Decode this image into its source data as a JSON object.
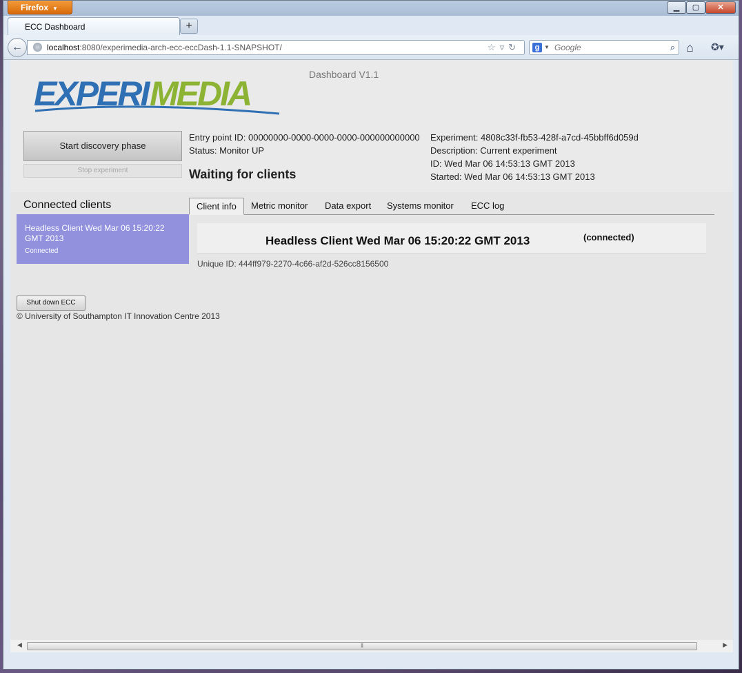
{
  "browser": {
    "app_button": "Firefox",
    "tab_title": "ECC Dashboard",
    "new_tab": "+",
    "url_host": "localhost",
    "url_rest": ":8080/experimedia-arch-ecc-eccDash-1.1-SNAPSHOT/",
    "search_placeholder": "Google",
    "controls": {
      "minimize": "▁",
      "maximize": "▢",
      "close": "✕"
    }
  },
  "header": {
    "logo_text_a": "EXPERI",
    "logo_text_b": "MEDIA",
    "version": "Dashboard V1.1",
    "start_button": "Start discovery phase",
    "stop_button": "Stop experiment",
    "entry_point": "Entry point ID: 00000000-0000-0000-0000-000000000000",
    "status": "Status: Monitor UP",
    "waiting": "Waiting for clients",
    "experiment": "Experiment: 4808c33f-fb53-428f-a7cd-45bbff6d059d",
    "description": "Description: Current experiment",
    "id": "ID: Wed Mar 06 14:53:13 GMT 2013",
    "started": "Started: Wed Mar 06 14:53:13 GMT 2013"
  },
  "clients": {
    "title": "Connected clients",
    "items": [
      {
        "name": "Headless Client Wed Mar 06 15:20:22 GMT 2013",
        "status": "Connected"
      }
    ]
  },
  "tabs": [
    "Client info",
    "Metric monitor",
    "Data export",
    "Systems monitor",
    "ECC log"
  ],
  "client_info": {
    "name": "Headless Client Wed Mar 06 15:20:22 GMT 2013",
    "state": "(connected)",
    "unique_id": "Unique ID: 444ff979-2270-4c66-af2d-526cc8156500"
  },
  "footer": {
    "shutdown": "Shut down ECC",
    "copyright": "© University of Southampton IT Innovation Centre 2013"
  },
  "colors": {
    "client_card": "#9191de",
    "logo_blue": "#2f6fb3",
    "logo_green": "#8db334"
  }
}
